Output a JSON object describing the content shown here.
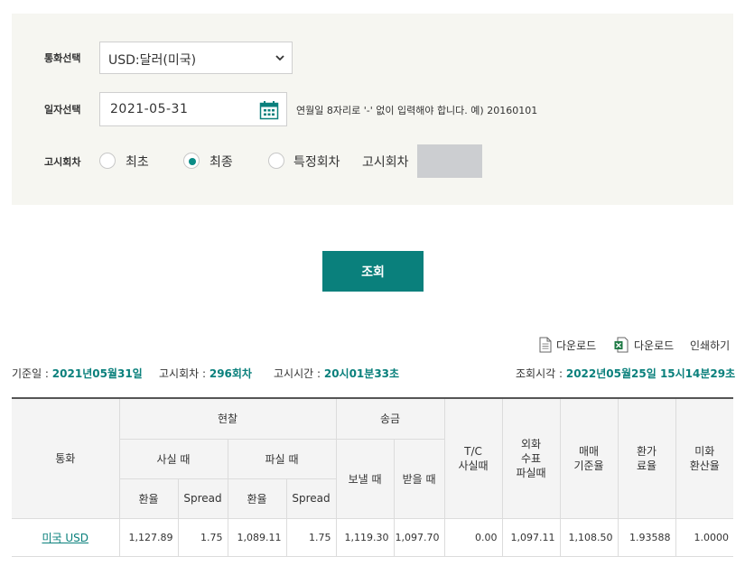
{
  "filters": {
    "currency_label": "통화선택",
    "currency_value": "USD:달러(미국)",
    "date_label": "일자선택",
    "date_value": "2021-05-31",
    "date_hint": "연월일 8자리로 '-' 없이 입력해야 합니다. 예) 20160101",
    "round_label": "고시회차",
    "round_options": [
      "최초",
      "최종",
      "특정회차"
    ],
    "round_selected": "최종",
    "specific_round_label": "고시회차"
  },
  "search_button": "조회",
  "tools": {
    "download_pdf": "다운로드",
    "download_excel": "다운로드",
    "print": "인쇄하기"
  },
  "info": {
    "base_date_label": "기준일 : ",
    "base_date": "2021년05월31일",
    "round_label": "고시회차 : ",
    "round": "296회차",
    "notice_time_label": "고시시간 : ",
    "notice_time": "20시01분33초",
    "query_time_label": "조회시각 : ",
    "query_time": "2022년05월25일 15시14분29초"
  },
  "table": {
    "headers": {
      "currency": "통화",
      "cash": "현찰",
      "cash_buy": "사실 때",
      "cash_sell": "파실 때",
      "rate": "환율",
      "spread": "Spread",
      "remit": "송금",
      "remit_send": "보낼 때",
      "remit_receive": "받을 때",
      "tc_1": "T/C",
      "tc_2": "사실때",
      "fx_check_1": "외화",
      "fx_check_2": "수표",
      "fx_check_3": "파실때",
      "base_rate_1": "매매",
      "base_rate_2": "기준율",
      "conv_rate_1": "환가",
      "conv_rate_2": "료율",
      "usd_conv_1": "미화",
      "usd_conv_2": "환산율"
    },
    "rows": [
      {
        "currency": "미국 USD",
        "cash_buy_rate": "1,127.89",
        "cash_buy_spread": "1.75",
        "cash_sell_rate": "1,089.11",
        "cash_sell_spread": "1.75",
        "remit_send": "1,119.30",
        "remit_receive": "1,097.70",
        "tc_buy": "0.00",
        "fx_check_sell": "1,097.11",
        "base_rate": "1,108.50",
        "conv_rate": "1.93588",
        "usd_conv": "1.0000"
      }
    ]
  },
  "colors": {
    "accent": "#0a807c",
    "panel_bg": "#f6f6f1"
  }
}
